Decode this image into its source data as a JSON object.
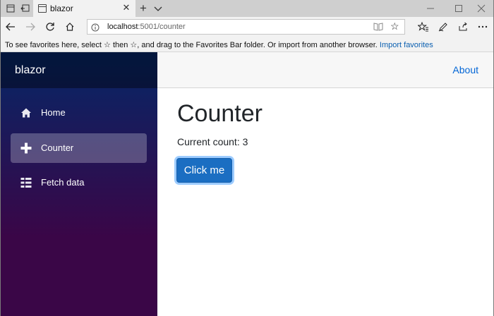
{
  "browser": {
    "tab_title": "blazor",
    "tab_close": "✕",
    "new_tab": "+",
    "address_host": "localhost",
    "address_path": ":5001/counter",
    "favorites_message_a": "To see favorites here, select",
    "favorites_message_b": "then ☆, and drag to the Favorites Bar folder. Or import from another browser.",
    "favorites_import_link": "Import favorites",
    "icons": [
      "window-icon",
      "back-tabs-icon",
      "chevron-down-icon",
      "minimize-icon",
      "maximize-icon",
      "close-icon",
      "back-arrow-icon",
      "forward-arrow-icon",
      "refresh-icon",
      "home-icon",
      "info-icon",
      "reading-view-icon",
      "star-icon",
      "favorites-icon",
      "pen-icon",
      "share-icon",
      "more-icon"
    ]
  },
  "app": {
    "brand": "blazor",
    "about_link": "About",
    "nav": [
      {
        "label": "Home",
        "icon": "home-icon",
        "active": false
      },
      {
        "label": "Counter",
        "icon": "plus-icon",
        "active": true
      },
      {
        "label": "Fetch data",
        "icon": "list-icon",
        "active": false
      }
    ],
    "page_title": "Counter",
    "count_label": "Current count: 3",
    "button_label": "Click me"
  },
  "colors": {
    "sidebar_top": "#052767",
    "sidebar_bottom": "#3a0647",
    "accent_blue": "#1b6ec2",
    "link_blue": "#0366d6"
  }
}
